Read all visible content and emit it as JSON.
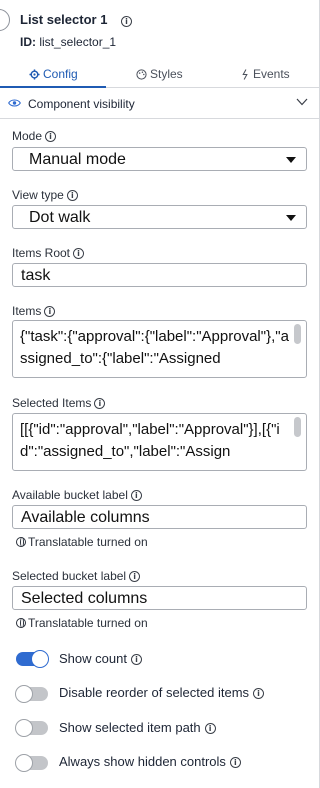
{
  "component": {
    "title": "List selector 1",
    "id_label": "ID:",
    "id_value": "list_selector_1"
  },
  "tabs": [
    {
      "label": "Config",
      "icon": "gear-icon",
      "active": true
    },
    {
      "label": "Styles",
      "icon": "palette-icon",
      "active": false
    },
    {
      "label": "Events",
      "icon": "lightning-icon",
      "active": false
    }
  ],
  "visibility": {
    "label": "Component visibility",
    "icon": "eye-icon"
  },
  "mode": {
    "label": "Mode",
    "value": "Manual mode"
  },
  "view_type": {
    "label": "View type",
    "value": "Dot walk"
  },
  "items_root": {
    "label": "Items Root",
    "value": "task"
  },
  "items": {
    "label": "Items",
    "value": "{\"task\":{\"approval\":{\"label\":\"Approval\"},\"assigned_to\":{\"label\":\"Assigned"
  },
  "selected_items": {
    "label": "Selected Items",
    "value": "[[{\"id\":\"approval\",\"label\":\"Approval\"}],[{\"id\":\"assigned_to\",\"label\":\"Assign"
  },
  "available_bucket": {
    "label": "Available bucket label",
    "value": "Available columns",
    "translatable": "Translatable turned on"
  },
  "selected_bucket": {
    "label": "Selected bucket label",
    "value": "Selected columns",
    "translatable": "Translatable turned on"
  },
  "toggles": [
    {
      "label": "Show count",
      "on": true
    },
    {
      "label": "Disable reorder of selected items",
      "on": false
    },
    {
      "label": "Show selected item path",
      "on": false
    },
    {
      "label": "Always show hidden controls",
      "on": false
    }
  ],
  "colors": {
    "accent": "#2f6bd0",
    "tab_active": "#1f5bb3"
  }
}
